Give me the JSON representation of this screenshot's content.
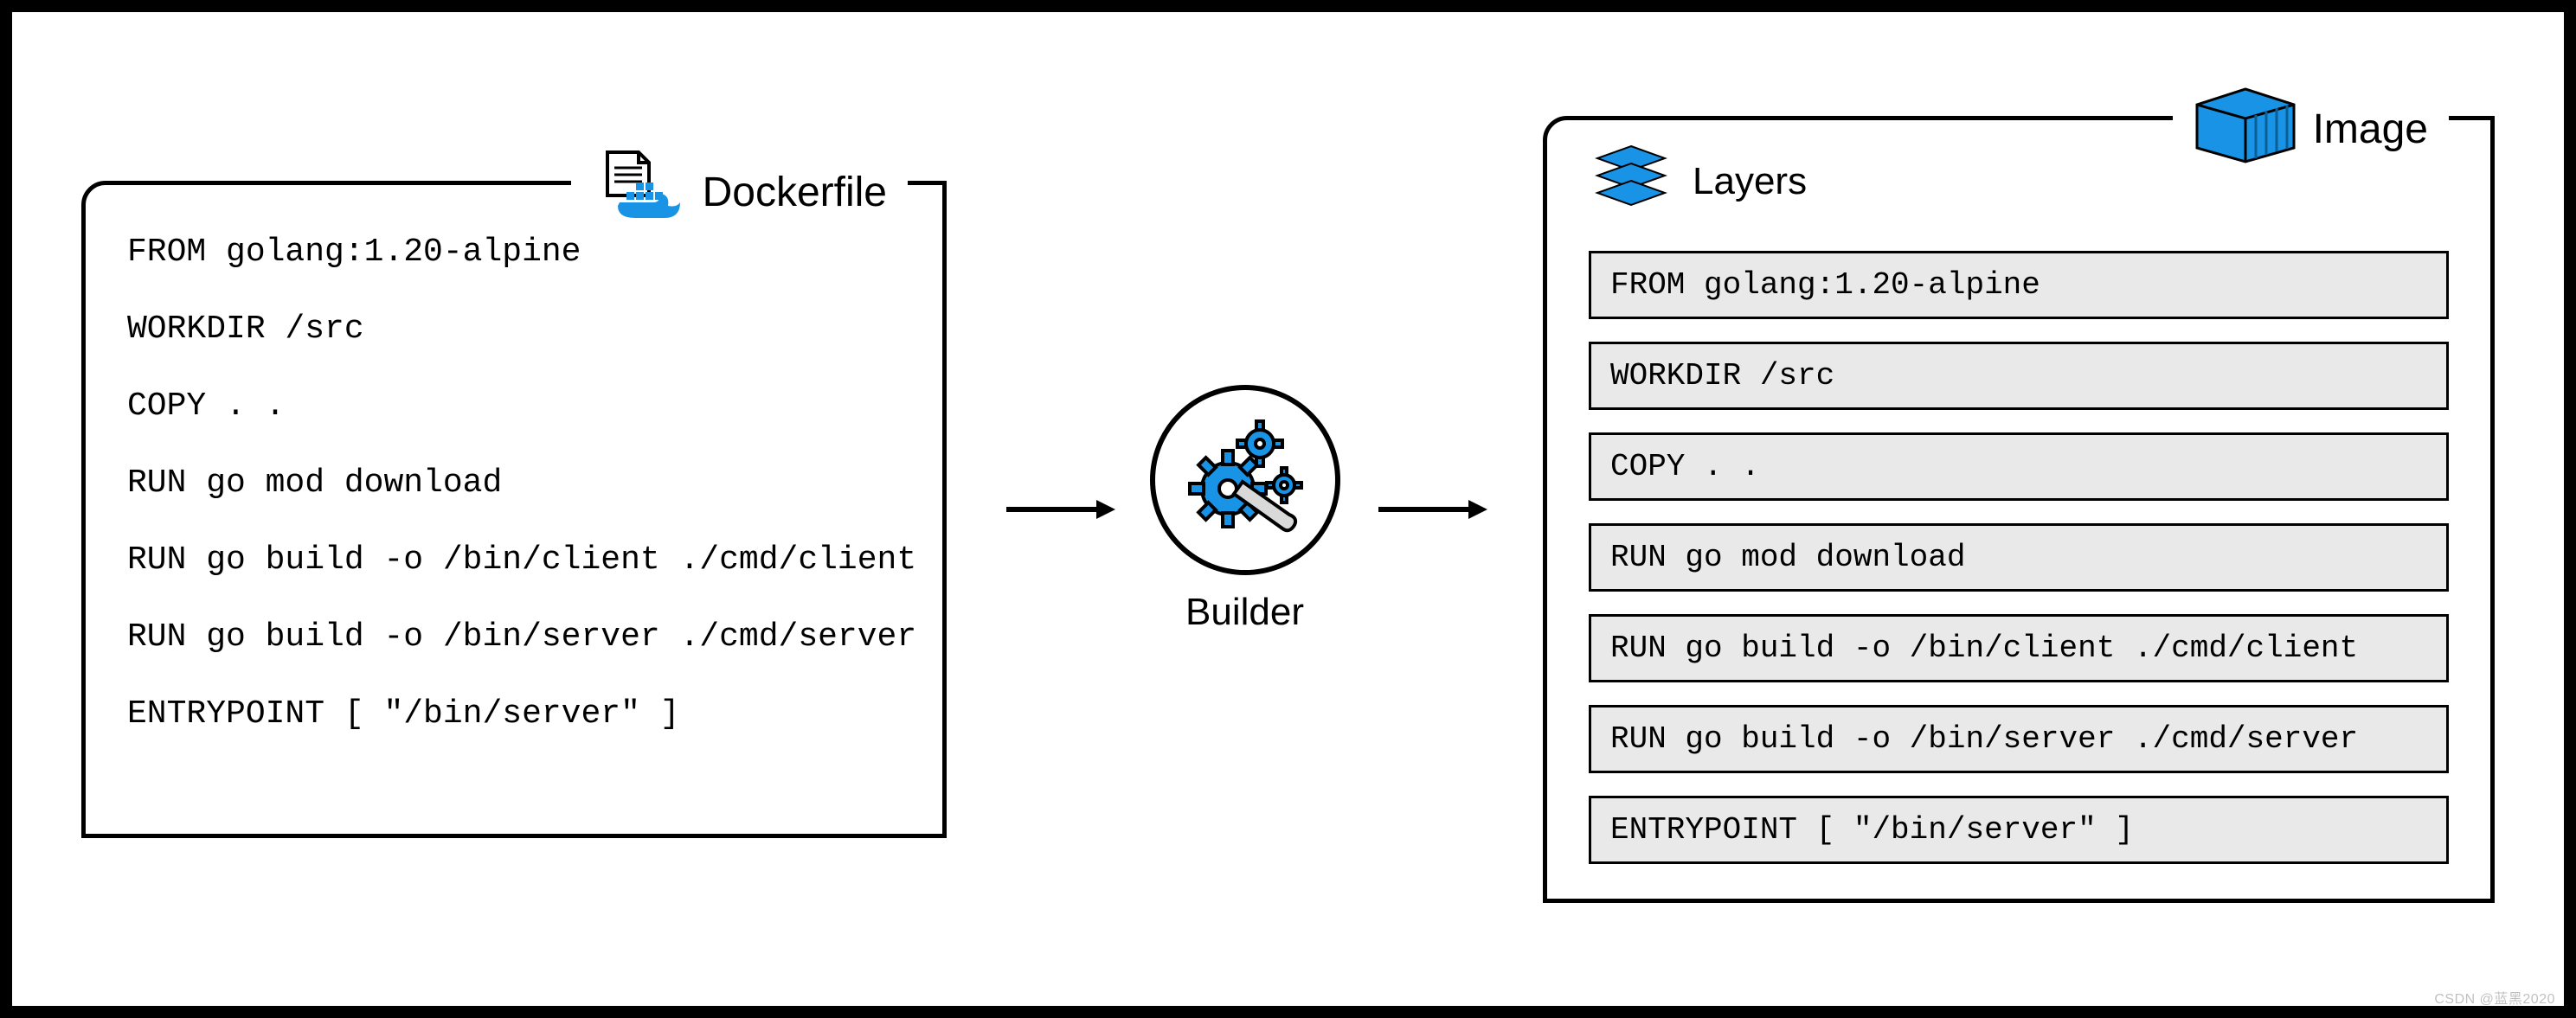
{
  "dockerfile": {
    "title": "Dockerfile",
    "lines": [
      "FROM golang:1.20-alpine",
      "WORKDIR /src",
      "COPY . .",
      "RUN go mod download",
      "RUN go build -o /bin/client ./cmd/client",
      "RUN go build -o /bin/server ./cmd/server",
      "ENTRYPOINT [ \"/bin/server\" ]"
    ]
  },
  "builder": {
    "label": "Builder"
  },
  "image": {
    "title": "Image",
    "layers_label": "Layers",
    "layers": [
      "FROM golang:1.20-alpine",
      "WORKDIR /src",
      "COPY . .",
      "RUN go mod download",
      "RUN go build -o /bin/client ./cmd/client",
      "RUN go build -o /bin/server ./cmd/server",
      "ENTRYPOINT [ \"/bin/server\" ]"
    ]
  },
  "colors": {
    "accent_blue": "#1993e5",
    "layer_bg": "#e9e9e9"
  },
  "watermark": "CSDN @蓝黑2020"
}
